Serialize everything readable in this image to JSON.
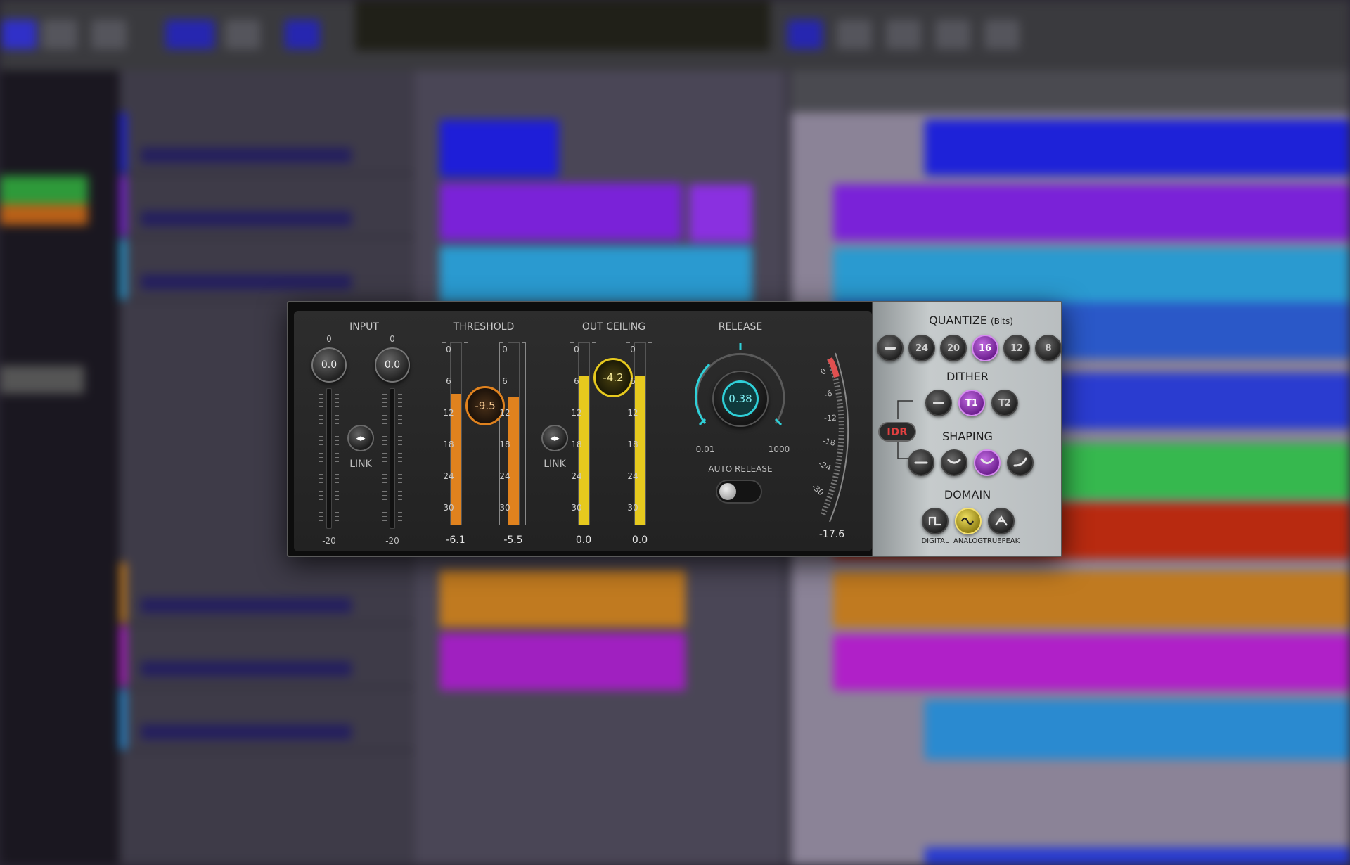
{
  "plugin": {
    "input": {
      "header": "INPUT",
      "left_top": "0",
      "right_top": "0",
      "left_value": "0.0",
      "right_value": "0.0",
      "left_bottom": "-20",
      "right_bottom": "-20",
      "link_label": "LINK"
    },
    "threshold": {
      "header": "THRESHOLD",
      "value": "-9.5",
      "left_readout": "-6.1",
      "right_readout": "-5.5",
      "link_label": "LINK",
      "left_level_fraction": 0.72,
      "right_level_fraction": 0.7
    },
    "out_ceiling": {
      "header": "OUT CEILING",
      "value": "-4.2",
      "left_readout": "0.0",
      "right_readout": "0.0",
      "left_level_fraction": 0.82,
      "right_level_fraction": 0.82
    },
    "meter_scale": [
      "0",
      "6",
      "12",
      "18",
      "24",
      "30"
    ],
    "release": {
      "header": "RELEASE",
      "value": "0.38",
      "min_label": "0.01",
      "max_label": "1000",
      "auto_label": "AUTO RELEASE",
      "auto_on": false
    },
    "gr_meter": {
      "scale": [
        "0",
        "-6",
        "-12",
        "-18",
        "-24",
        "-30"
      ],
      "readout": "-17.6"
    },
    "quantize": {
      "header": "QUANTIZE",
      "header_unit": "(Bits)",
      "options": [
        "—",
        "24",
        "20",
        "16",
        "12",
        "8"
      ],
      "selected": "16"
    },
    "dither": {
      "header": "DITHER",
      "options": [
        "—",
        "T1",
        "T2"
      ],
      "selected": "T1",
      "idr_label": "IDR"
    },
    "shaping": {
      "header": "SHAPING",
      "options": [
        "none",
        "curve-1",
        "curve-2",
        "curve-3"
      ],
      "selected": "curve-2"
    },
    "domain": {
      "header": "DOMAIN",
      "options": [
        "DIGITAL",
        "ANALOG",
        "TRUEPEAK"
      ],
      "selected": "ANALOG"
    },
    "colors": {
      "threshold_meter": "#e0821e",
      "ceiling_meter": "#e6c91e",
      "release_accent": "#2fd0d8",
      "selected_purple": "#a43ccc",
      "selected_yellow": "#e6d43a",
      "idr_red": "#e04040"
    }
  },
  "background": {
    "track_colors": [
      "#1e22d8",
      "#7a22d8",
      "#2a9ad0",
      "#2a58c8",
      "#2a3cd0",
      "#36b84e",
      "#b82a10",
      "#c07a20",
      "#b020c8",
      "#2a8ad0"
    ],
    "note": ""
  }
}
